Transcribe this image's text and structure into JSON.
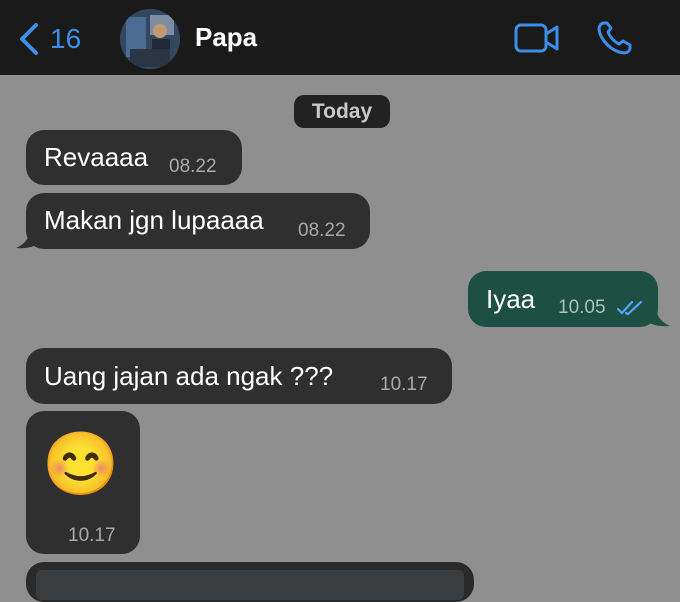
{
  "header": {
    "back_count": "16",
    "contact_name": "Papa",
    "icons": [
      "back-chevron-icon",
      "video-call-icon",
      "phone-icon"
    ],
    "accent_color": "#3b8fe8"
  },
  "date_divider": "Today",
  "messages": [
    {
      "direction": "in",
      "text": "Revaaaa",
      "time": "08.22"
    },
    {
      "direction": "in",
      "text": "Makan jgn lupaaaa",
      "time": "08.22"
    },
    {
      "direction": "out",
      "text": "Iyaa",
      "time": "10.05",
      "status": "read"
    },
    {
      "direction": "in",
      "text": "Uang jajan ada ngak ???",
      "time": "10.17"
    },
    {
      "direction": "in",
      "text": "😊",
      "time": "10.17",
      "kind": "emoji"
    }
  ],
  "colors": {
    "chat_background": "#8f8f8f",
    "header_background": "#1a1a1a",
    "incoming_bubble": "#2f2f2f",
    "outgoing_bubble": "#1d4f43",
    "read_ticks": "#53a6ff"
  }
}
